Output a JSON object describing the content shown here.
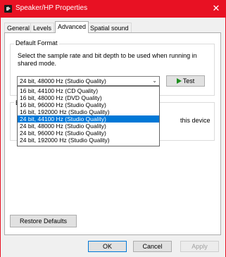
{
  "window": {
    "title": "Speaker/HP Properties",
    "close_glyph": "✕"
  },
  "tabs": [
    {
      "label": "General",
      "active": false
    },
    {
      "label": "Levels",
      "active": false
    },
    {
      "label": "Advanced",
      "active": true
    },
    {
      "label": "Spatial sound",
      "active": false
    }
  ],
  "default_format": {
    "group_label": "Default Format",
    "description": "Select the sample rate and bit depth to be used when running in shared mode.",
    "selected_value": "24 bit, 48000 Hz (Studio Quality)",
    "test_label": "Test"
  },
  "dropdown": {
    "options": [
      "16 bit, 44100 Hz (CD Quality)",
      "16 bit, 48000 Hz (DVD Quality)",
      "16 bit, 96000 Hz (Studio Quality)",
      "16 bit, 192000 Hz (Studio Quality)",
      "24 bit, 44100 Hz (Studio Quality)",
      "24 bit, 48000 Hz (Studio Quality)",
      "24 bit, 96000 Hz (Studio Quality)",
      "24 bit, 192000 Hz (Studio Quality)"
    ],
    "highlighted": "24 bit, 44100 Hz (Studio Quality)"
  },
  "exclusive_mode": {
    "group_label_fragment": "E",
    "obscured_text": "this device"
  },
  "buttons": {
    "restore": "Restore Defaults",
    "ok": "OK",
    "cancel": "Cancel",
    "apply": "Apply"
  },
  "colors": {
    "titlebar": "#e81123",
    "selection": "#0078d7",
    "play": "#1e8e1e"
  }
}
